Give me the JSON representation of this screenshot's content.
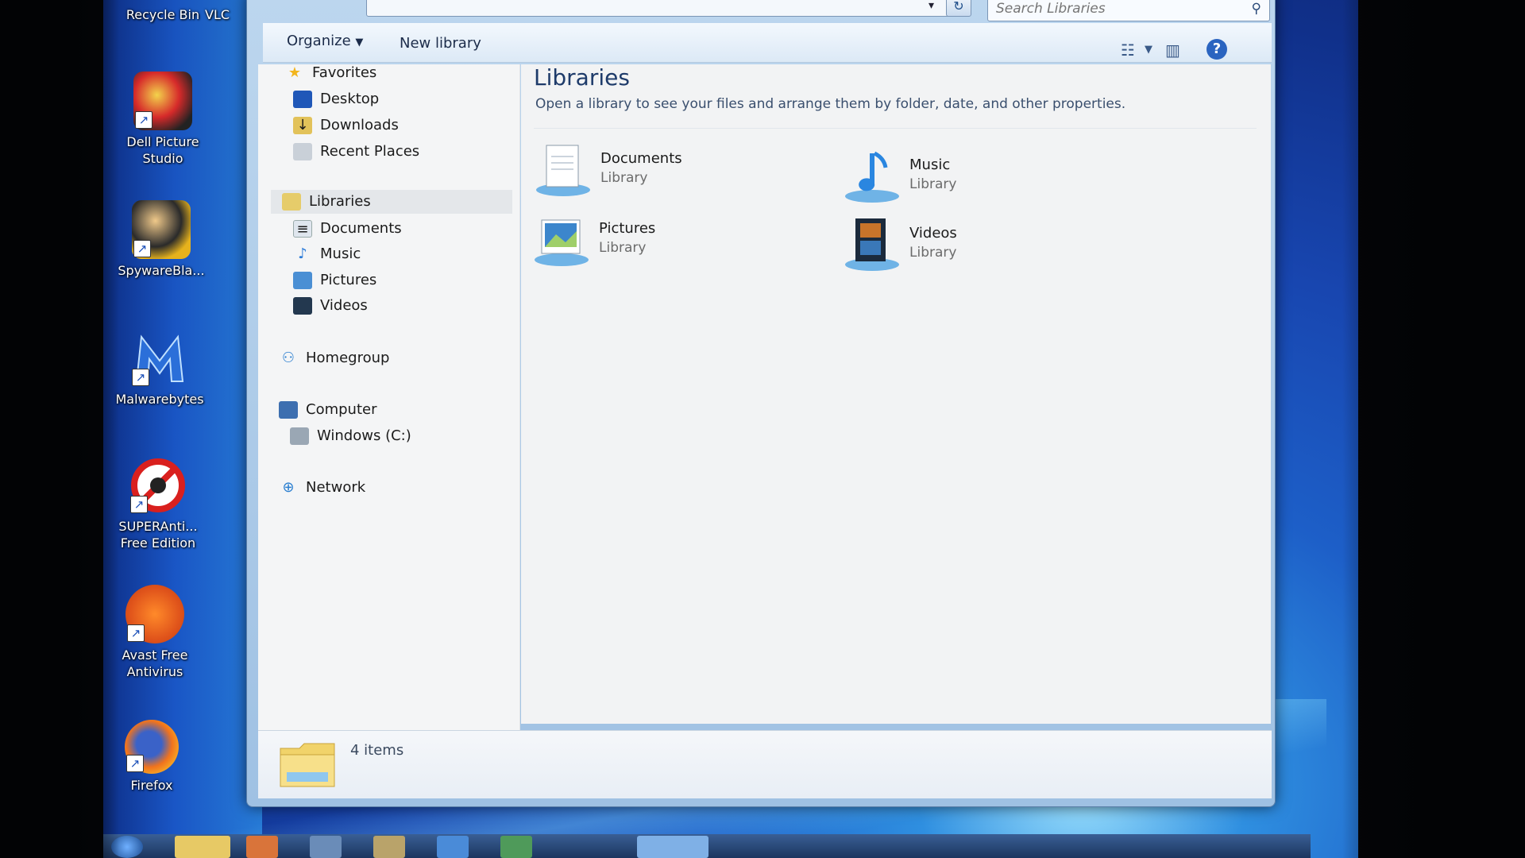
{
  "desktop": {
    "icons": [
      {
        "label": "Recycle Bin",
        "icon": "recycle-bin-icon"
      },
      {
        "label": "VLC",
        "icon": "vlc-icon"
      },
      {
        "label": "Dell Picture Studio",
        "icon": "dell-picture-studio-icon"
      },
      {
        "label": "SpywareBla...",
        "icon": "spywareblaster-icon"
      },
      {
        "label": "Malwarebytes",
        "icon": "malwarebytes-icon"
      },
      {
        "label": "SUPERAnti... Free Edition",
        "icon": "superantispyware-icon"
      },
      {
        "label": "Avast Free Antivirus",
        "icon": "avast-icon"
      },
      {
        "label": "Firefox",
        "icon": "firefox-icon"
      }
    ]
  },
  "window": {
    "search": {
      "placeholder": "Search Libraries"
    },
    "toolbar": {
      "organize": "Organize",
      "new_library": "New library",
      "icons": [
        "change-view-icon",
        "preview-pane-icon",
        "help-icon"
      ]
    },
    "nav": {
      "favorites": {
        "label": "Favorites",
        "items": [
          "Desktop",
          "Downloads",
          "Recent Places"
        ]
      },
      "libraries": {
        "label": "Libraries",
        "items": [
          "Documents",
          "Music",
          "Pictures",
          "Videos"
        ]
      },
      "homegroup": "Homegroup",
      "computer": {
        "label": "Computer",
        "items": [
          "Windows (C:)"
        ]
      },
      "network": "Network"
    },
    "content": {
      "title": "Libraries",
      "description": "Open a library to see your files and arrange them by folder, date, and other properties.",
      "libraries": [
        {
          "name": "Documents",
          "type": "Library"
        },
        {
          "name": "Music",
          "type": "Library"
        },
        {
          "name": "Pictures",
          "type": "Library"
        },
        {
          "name": "Videos",
          "type": "Library"
        }
      ]
    },
    "details": {
      "count": "4 items"
    }
  },
  "colors": {
    "accent": "#1e3b6a",
    "nav_bg": "#f4f5f6",
    "toolbar_bg": "#dce9f6"
  }
}
